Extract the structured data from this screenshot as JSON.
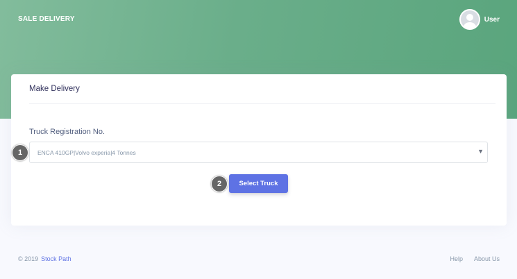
{
  "header": {
    "brand": "SALE DELIVERY",
    "user_name": "User",
    "avatar_icon": "user-avatar-icon"
  },
  "card": {
    "title": "Make Delivery",
    "field_label": "Truck Registration No.",
    "select_value": "ENCA 410GP|Volvo experia|4 Tonnes",
    "caret_icon": "caret-down-icon",
    "button_label": "Select Truck"
  },
  "annotations": {
    "badge_1": "1",
    "badge_2": "2"
  },
  "footer": {
    "copyright": "© 2019",
    "company_link": "Stock Path",
    "links": [
      "Help",
      "About Us"
    ]
  },
  "colors": {
    "header_green": "#6aae8a",
    "primary": "#5e72e4",
    "muted": "#8898aa",
    "badge": "#666666"
  }
}
